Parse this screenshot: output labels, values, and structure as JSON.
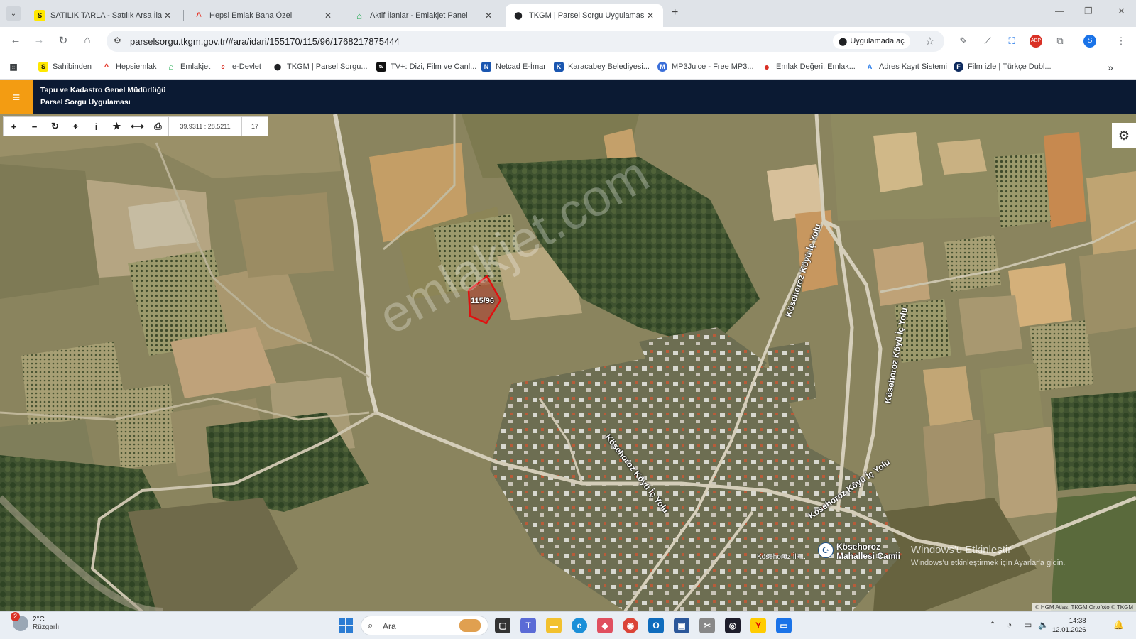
{
  "browser": {
    "tabs": [
      {
        "title": "SATILIK TARLA - Satılık Arsa İlanları",
        "favicon": "sahibinden-icon",
        "favicon_text": "S"
      },
      {
        "title": "Hepsi Emlak Bana Özel",
        "favicon": "hepsiemlak-icon",
        "favicon_text": "^"
      },
      {
        "title": "Aktif İlanlar - Emlakjet Panel",
        "favicon": "emlakjet-icon",
        "favicon_text": "⌂"
      },
      {
        "title": "TKGM | Parsel Sorgu Uygulaması",
        "favicon": "map-pin-icon",
        "favicon_text": "⬤",
        "active": true
      }
    ],
    "close_glyph": "✕",
    "newtab_glyph": "+",
    "window_controls": [
      "—",
      "❐",
      "✕"
    ],
    "url": "parselsorgu.tkgm.gov.tr/#ara/idari/155170/115/96/1768217875444",
    "open_in_app": "Uygulamada aç",
    "nav": {
      "back": "←",
      "forward": "→",
      "reload": "↻",
      "home": "⌂"
    },
    "bookmarks": [
      {
        "label": "Sahibinden",
        "icon_text": "S"
      },
      {
        "label": "Hepsiemlak",
        "icon_text": "^"
      },
      {
        "label": "Emlakjet",
        "icon_text": "⌂"
      },
      {
        "label": "e-Devlet",
        "icon_text": "e"
      },
      {
        "label": "TKGM | Parsel Sorgu...",
        "icon_text": "⬤"
      },
      {
        "label": "TV+: Dizi, Film ve Canl...",
        "icon_text": "tv"
      },
      {
        "label": "Netcad E-İmar",
        "icon_text": "N"
      },
      {
        "label": "Karacabey Belediyesi...",
        "icon_text": "K"
      },
      {
        "label": "MP3Juice - Free MP3...",
        "icon_text": "M"
      },
      {
        "label": "Emlak Değeri, Emlak...",
        "icon_text": "●"
      },
      {
        "label": "Adres Kayıt Sistemi",
        "icon_text": "A"
      },
      {
        "label": "Film izle | Türkçe Dubl...",
        "icon_text": "F"
      }
    ],
    "more_bookmarks": "»"
  },
  "app": {
    "menu_glyph": "≡",
    "title_line1": "Tapu ve Kadastro Genel Müdürlüğü",
    "title_line2": "Parsel Sorgu Uygulaması",
    "accent": "#f39c12",
    "header_bg": "#0b1a33"
  },
  "map": {
    "tools": [
      "+",
      "−",
      "↻",
      "⌖",
      "i",
      "★",
      "⟷",
      "⎙"
    ],
    "coordinates": "39.9311 : 28.5211",
    "zoom": "17",
    "settings_glyph": "⚙",
    "parcel_label": "115/96",
    "road_labels": [
      "Kösehoroz Köyü İç Yolu",
      "Kösehoroz Köyü İç Yolu",
      "Kösehoroz Köyü İç Yolu",
      "Kösehoroz Köyü İç Yolu"
    ],
    "watermark": "emlakjet.com",
    "mosque_name_line1": "Kösehoroz",
    "mosque_name_line2": "Mahallesi Camii",
    "small_label": "Kösehoroz İlk...",
    "windows_activation_title": "Windows'u Etkinleştir",
    "windows_activation_sub": "Windows'u etkinleştirmek için Ayarlar'a gidin.",
    "attribution": "© HGM Atlas, TKGM Ortofoto © TKGM"
  },
  "taskbar": {
    "weather_temp": "2°C",
    "weather_desc": "Rüzgarlı",
    "weather_badge": "2",
    "search_placeholder": "Ara",
    "time": "14:38",
    "date": "12.01.2026"
  }
}
